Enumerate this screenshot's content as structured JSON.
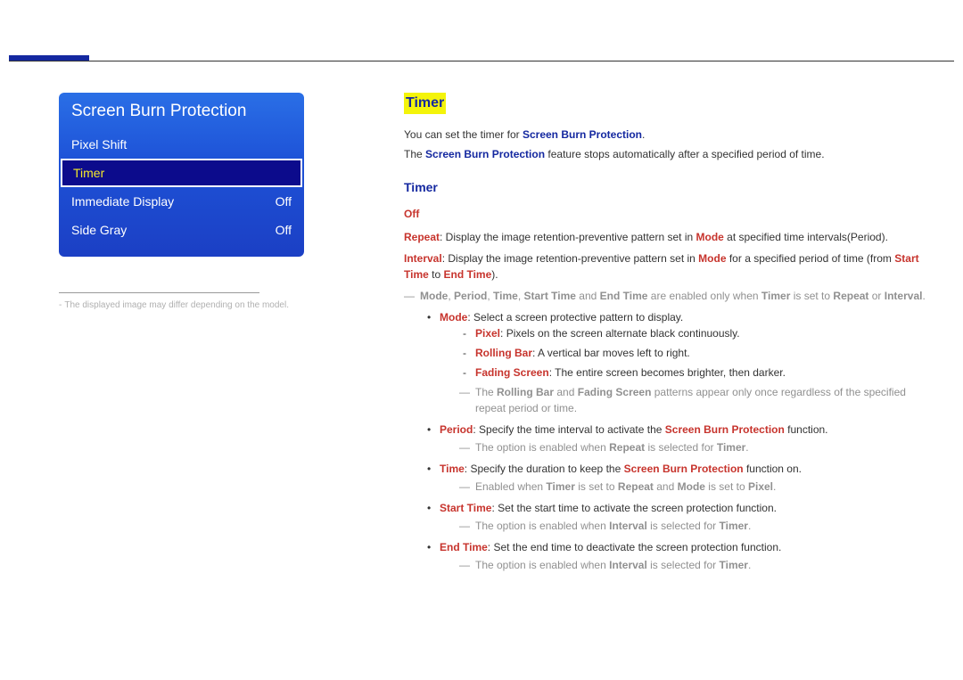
{
  "menu": {
    "title": "Screen Burn Protection",
    "items": [
      {
        "label": "Pixel Shift",
        "value": ""
      },
      {
        "label": "Timer",
        "value": ""
      },
      {
        "label": "Immediate Display",
        "value": "Off"
      },
      {
        "label": "Side Gray",
        "value": "Off"
      }
    ]
  },
  "footnote": "The displayed image may differ depending on the model.",
  "section": {
    "title": "Timer",
    "intro1_a": "You can set the timer for ",
    "intro1_b": "Screen Burn Protection",
    "intro1_c": ".",
    "intro2_a": "The ",
    "intro2_b": "Screen Burn Protection",
    "intro2_c": " feature stops automatically after a specified period of time.",
    "subTitle": "Timer",
    "off": "Off",
    "repeat_label": "Repeat",
    "repeat_text": ": Display the image retention-preventive pattern set in ",
    "repeat_mode": "Mode",
    "repeat_tail": " at specified time intervals(Period).",
    "interval_label": "Interval",
    "interval_text": ": Display the image retention-preventive pattern set in ",
    "interval_mode": "Mode",
    "interval_mid": " for a specified period of time (from ",
    "interval_start": "Start Time",
    "interval_to": " to ",
    "interval_end": "End Time",
    "interval_close": ").",
    "note1_parts": {
      "a": "Mode",
      "b": "Period",
      "c": "Time",
      "d": "Start Time",
      "e": "End Time",
      "txt1": " and ",
      "txt2": " are enabled only when ",
      "f": "Timer",
      "txt3": " is set to ",
      "g": "Repeat",
      "txt4": " or ",
      "h": "Interval",
      "txt5": "."
    },
    "mode_label": "Mode",
    "mode_text": ": Select a screen protective pattern to display.",
    "pixel_label": "Pixel",
    "pixel_text": ": Pixels on the screen alternate black continuously.",
    "rolling_label": "Rolling Bar",
    "rolling_text": ": A vertical bar moves left to right.",
    "fading_label": "Fading Screen",
    "fading_text": ": The entire screen becomes brighter, then darker.",
    "note2_a": "The ",
    "note2_b": "Rolling Bar",
    "note2_c": " and ",
    "note2_d": "Fading Screen",
    "note2_e": " patterns appear only once regardless of the specified repeat period or time.",
    "period_label": "Period",
    "period_text": ": Specify the time interval to activate the ",
    "period_sbp": "Screen Burn Protection",
    "period_tail": " function.",
    "period_note_a": "The option is enabled when ",
    "period_note_b": "Repeat",
    "period_note_c": " is selected for ",
    "period_note_d": "Timer",
    "period_note_e": ".",
    "time_label": "Time",
    "time_text": ": Specify the duration to keep the ",
    "time_sbp": "Screen Burn Protection",
    "time_tail": " function on.",
    "time_note_a": "Enabled when ",
    "time_note_b": "Timer",
    "time_note_c": " is set to ",
    "time_note_d": "Repeat",
    "time_note_e": " and ",
    "time_note_f": "Mode",
    "time_note_g": " is set to ",
    "time_note_h": "Pixel",
    "time_note_i": ".",
    "start_label": "Start Time",
    "start_text": ": Set the start time to activate the screen protection function.",
    "start_note_a": "The option is enabled when ",
    "start_note_b": "Interval",
    "start_note_c": " is selected for ",
    "start_note_d": "Timer",
    "start_note_e": ".",
    "end_label": "End Time",
    "end_text": ": Set the end time to deactivate the screen protection function.",
    "end_note_a": "The option is enabled when ",
    "end_note_b": "Interval",
    "end_note_c": " is selected for ",
    "end_note_d": "Timer",
    "end_note_e": "."
  }
}
